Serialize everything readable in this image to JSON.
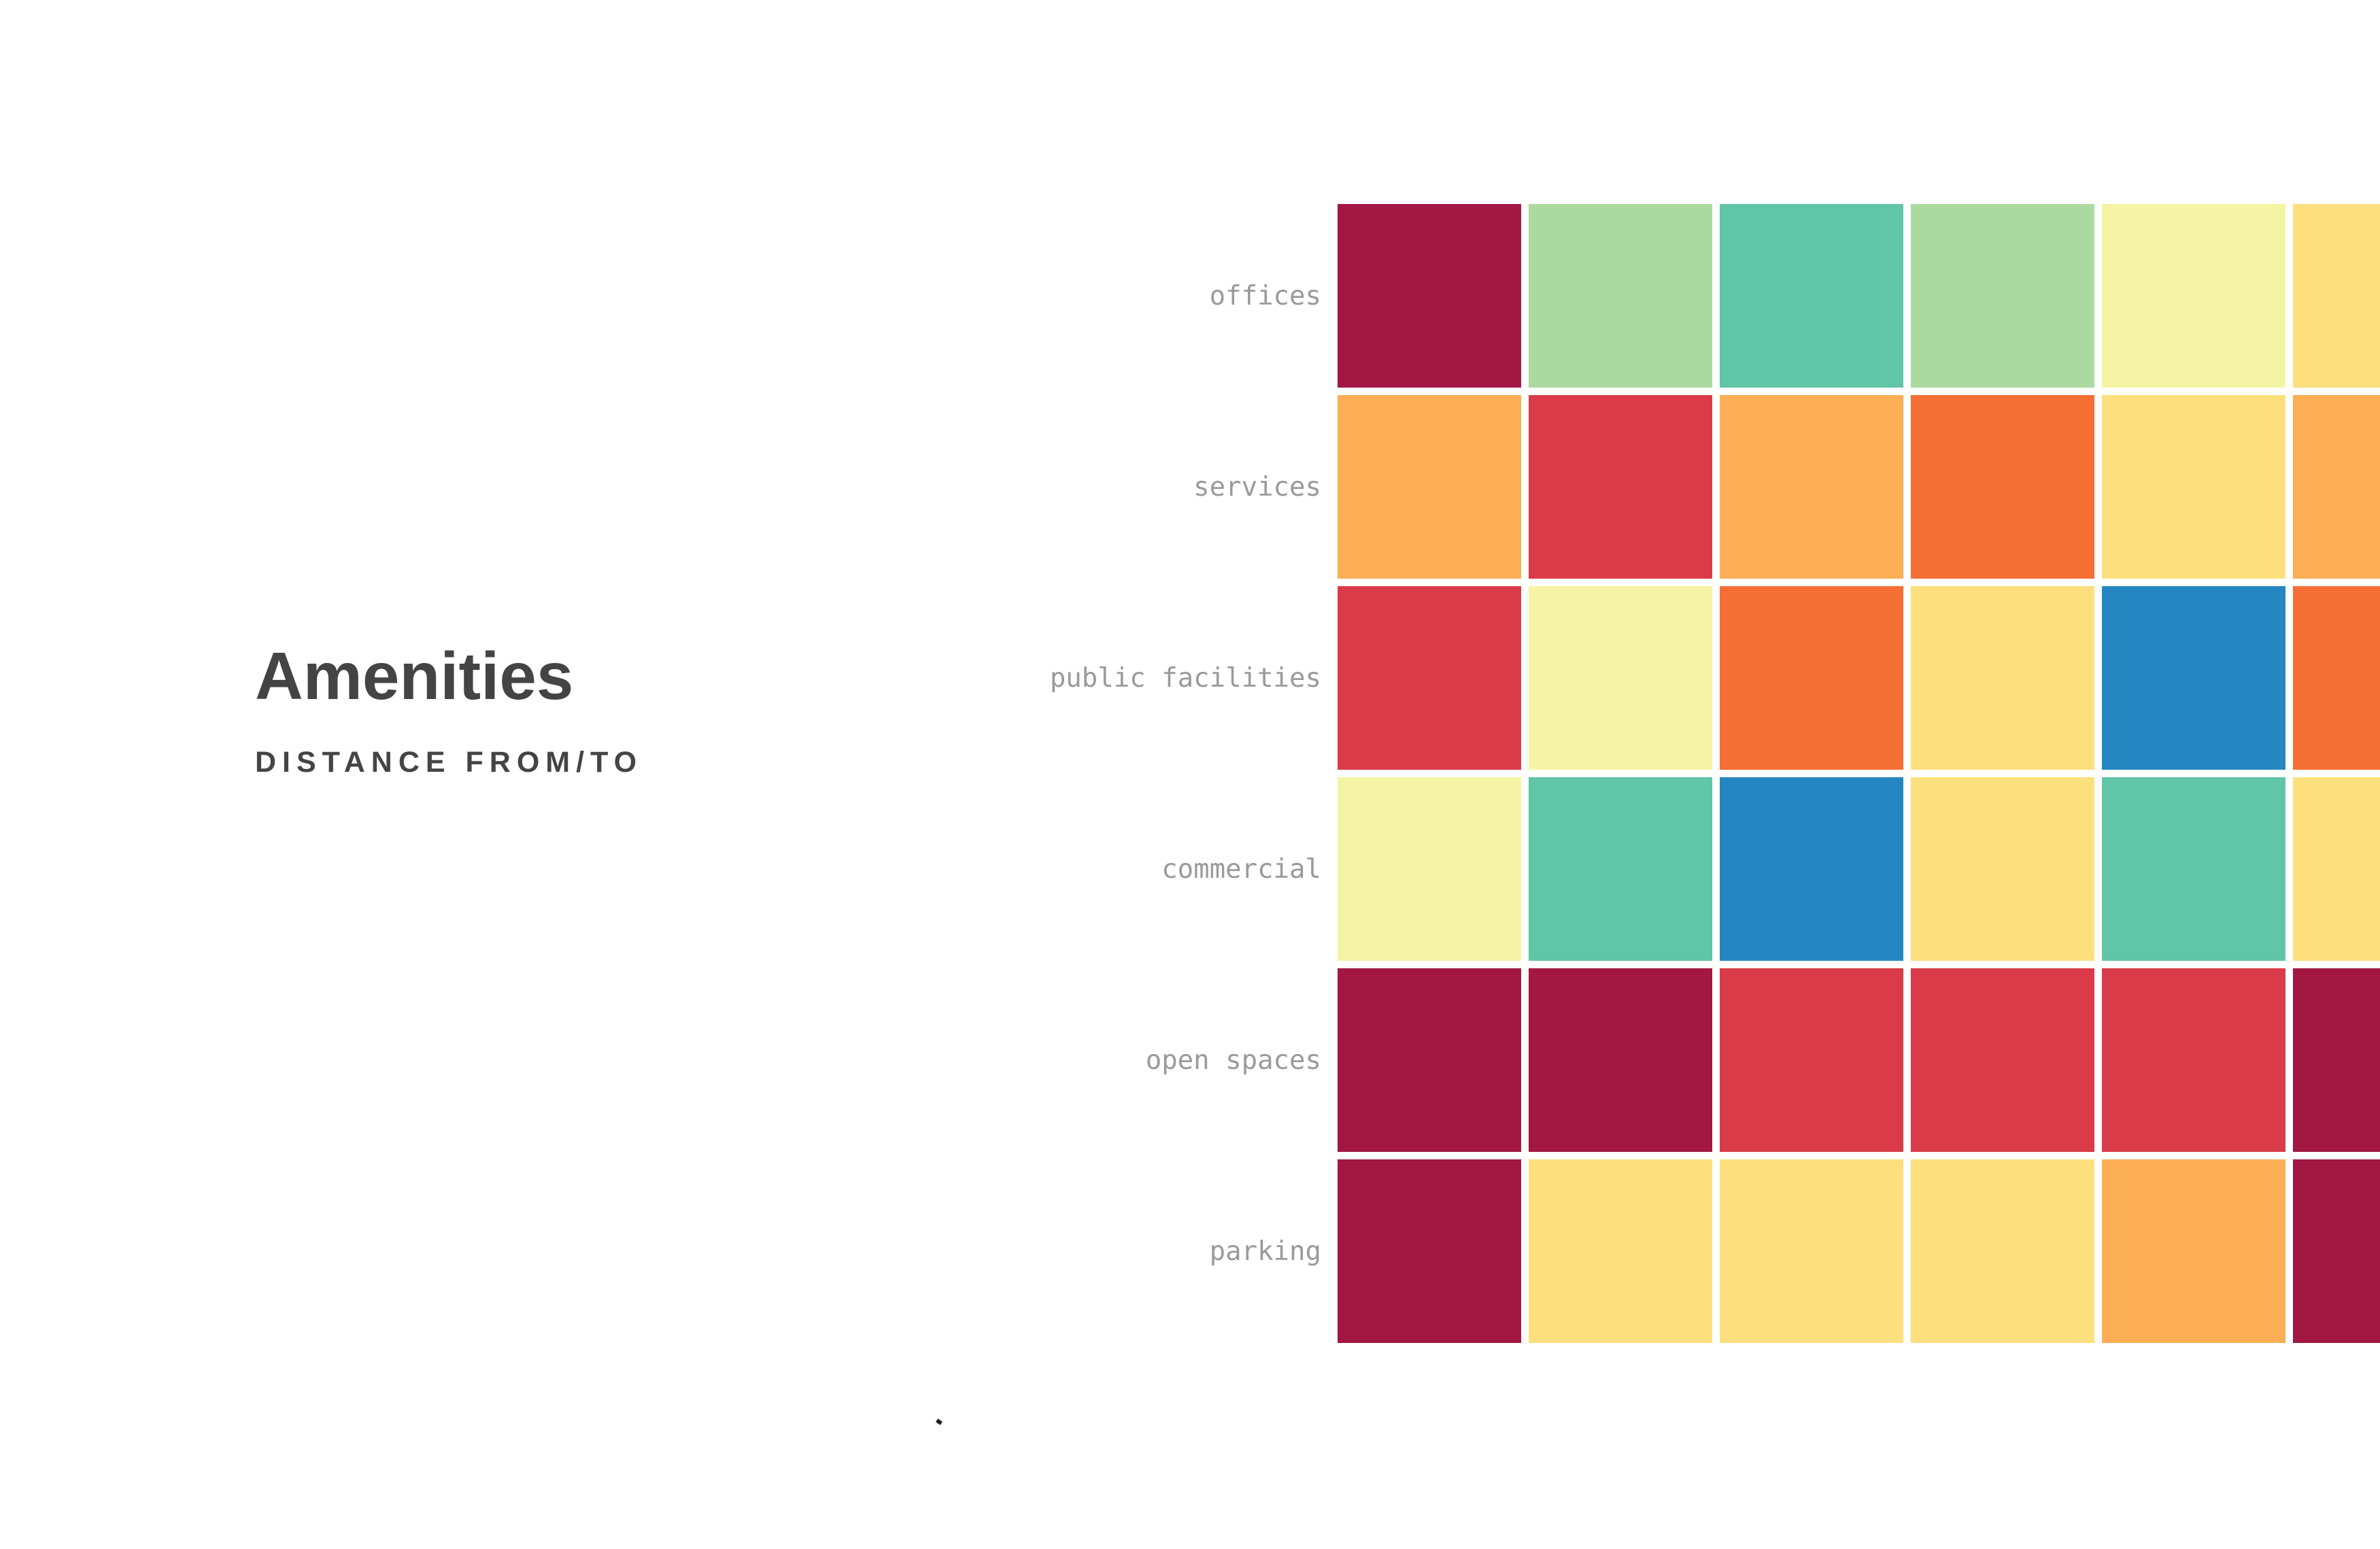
{
  "header": {
    "title": "Amenities",
    "subtitle": "DISTANCE FROM/TO"
  },
  "chart_data": {
    "type": "heatmap",
    "title": "Amenities",
    "subtitle": "DISTANCE FROM/TO",
    "rows": [
      "offices",
      "services",
      "public facilities",
      "commercial",
      "open spaces",
      "parking"
    ],
    "color_scale": {
      "levels": [
        1,
        2,
        3,
        4,
        5,
        6,
        7,
        8,
        9
      ],
      "colors": [
        "#a21843",
        "#da3b48",
        "#f56e34",
        "#fbae54",
        "#fedf7d",
        "#f5f4a4",
        "#acd9a0",
        "#61c5a7",
        "#2587c1"
      ]
    },
    "values": [
      [
        1,
        7,
        8,
        7,
        6,
        5
      ],
      [
        4,
        2,
        4,
        3,
        5,
        4
      ],
      [
        2,
        6,
        3,
        5,
        9,
        3
      ],
      [
        6,
        8,
        9,
        5,
        8,
        5
      ],
      [
        1,
        1,
        2,
        2,
        2,
        1
      ],
      [
        1,
        5,
        5,
        5,
        4,
        1
      ]
    ]
  }
}
